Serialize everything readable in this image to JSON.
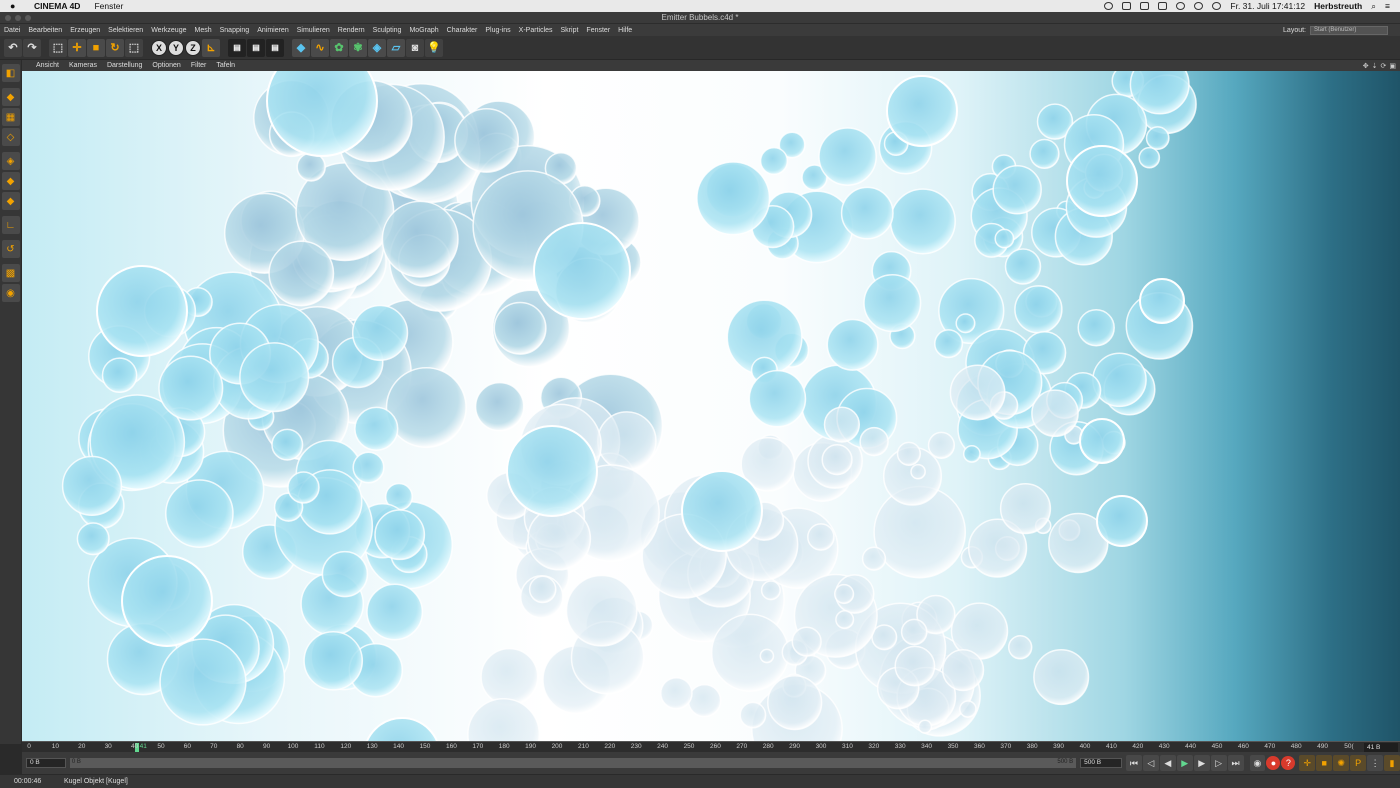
{
  "mac_menubar": {
    "app_name": "CINEMA 4D",
    "menu": "Fenster",
    "datetime": "Fr. 31. Juli  17:41:12",
    "user": "Herbstreuth"
  },
  "window": {
    "title": "Emitter Bubbels.c4d *"
  },
  "main_menu": {
    "items": [
      "Datei",
      "Bearbeiten",
      "Erzeugen",
      "Selektieren",
      "Werkzeuge",
      "Mesh",
      "Snapping",
      "Animieren",
      "Simulieren",
      "Rendern",
      "Sculpting",
      "MoGraph",
      "Charakter",
      "Plug-ins",
      "X-Particles",
      "Skript",
      "Fenster",
      "Hilfe"
    ],
    "layout_label": "Layout:",
    "layout_value": "Start (Benutzer)"
  },
  "toolbar": {
    "undo_icon": "undo-icon",
    "axis_x": "X",
    "axis_y": "Y",
    "axis_z": "Z"
  },
  "viewport_menu": {
    "items": [
      "Ansicht",
      "Kameras",
      "Darstellung",
      "Optionen",
      "Filter",
      "Tafeln"
    ]
  },
  "timeline": {
    "ticks": [
      "0",
      "10",
      "20",
      "30",
      "40",
      "50",
      "60",
      "70",
      "80",
      "90",
      "100",
      "110",
      "120",
      "130",
      "140",
      "150",
      "160",
      "170",
      "180",
      "190",
      "200",
      "210",
      "220",
      "230",
      "240",
      "250",
      "260",
      "270",
      "280",
      "290",
      "300",
      "310",
      "320",
      "330",
      "340",
      "350",
      "360",
      "370",
      "380",
      "390",
      "400",
      "410",
      "420",
      "430",
      "440",
      "450",
      "460",
      "470",
      "480",
      "490",
      "50("
    ],
    "current_frame": 41,
    "current_frame_label": "41",
    "current_display": "41 B"
  },
  "playback": {
    "start_field": "0 B",
    "range_start": "0 B",
    "range_end": "500 B",
    "end_field": "500 B"
  },
  "status": {
    "time": "00:00:46",
    "message": "Kugel Objekt [Kugel]"
  },
  "colors": {
    "accent": "#f2a200",
    "play": "#62d890",
    "record": "#d83a2c"
  }
}
